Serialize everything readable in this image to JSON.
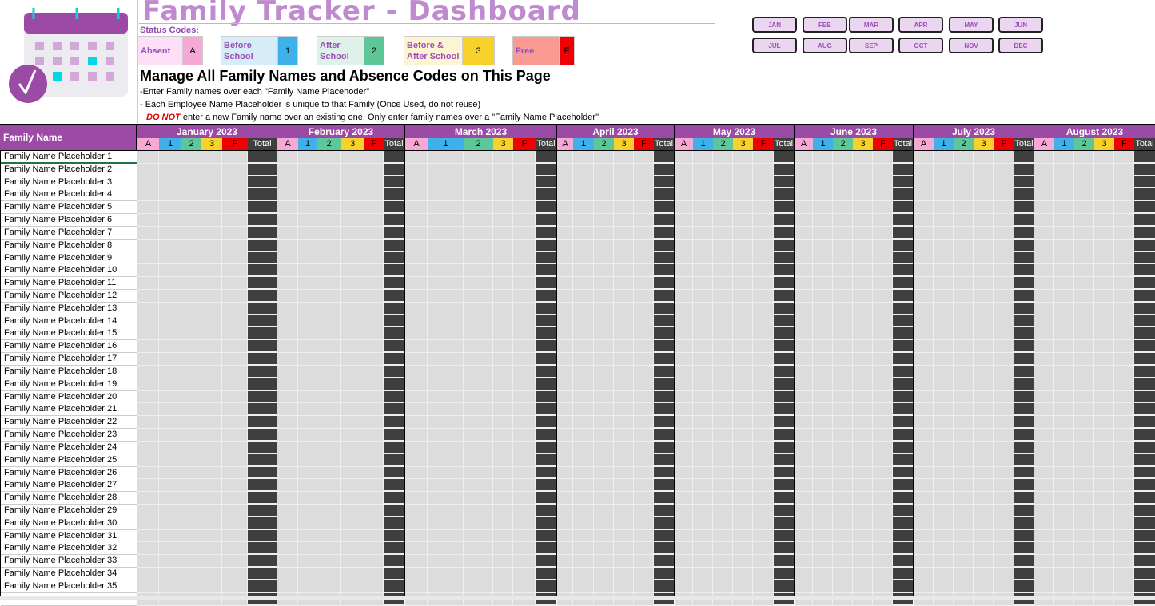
{
  "title": "Family Tracker - Dashboard",
  "status_label": "Status Codes:",
  "status_codes": [
    {
      "label": "Absent",
      "key": "A",
      "bg": "#fde0f8",
      "key_bg": "#f7a8d4"
    },
    {
      "label": "Before School",
      "key": "1",
      "bg": "#d6ecf7",
      "key_bg": "#3fb1ea"
    },
    {
      "label": "After School",
      "key": "2",
      "bg": "#dff2ea",
      "key_bg": "#5ec79a"
    },
    {
      "label": "Before & After School",
      "key": "3",
      "bg": "#fdf4d4",
      "key_bg": "#f8d12a"
    },
    {
      "label": "Free",
      "key": "F",
      "bg": "#fb9a93",
      "key_bg": "#f00000"
    }
  ],
  "heading": "Manage All Family Names and Absence Codes on This Page",
  "notes": {
    "line1": "-Enter Family names over each \"Family Name Placehoder\"",
    "line2": "-  Each Employee Name Placeholder is unique to that Family (Once Used, do not reuse)",
    "line3_warn": "DO NOT",
    "line3": " enter a new Family name over an existing one.  Only enter family names over a \"Family Name Placeholder\""
  },
  "month_buttons": [
    "JAN",
    "FEB",
    "MAR",
    "APR",
    "MAY",
    "JUN",
    "JUL",
    "AUG",
    "SEP",
    "OCT",
    "NOV",
    "DEC"
  ],
  "grid": {
    "name_header": "Family Name",
    "months": [
      "January 2023",
      "February 2023",
      "March 2023",
      "April 2023",
      "May 2023",
      "June 2023",
      "July 2023",
      "August 2023"
    ],
    "sub_headers": [
      "A",
      "1",
      "2",
      "3",
      "F",
      "Total"
    ],
    "sub_colors": [
      "#f7a8d4",
      "#3fb1ea",
      "#5ec79a",
      "#f8d12a",
      "#f00000",
      "#3f3f3f"
    ],
    "rows": [
      "Family Name Placeholder 1",
      "Family Name Placeholder 2",
      "Family Name Placeholder 3",
      "Family Name Placeholder 4",
      "Family Name Placeholder 5",
      "Family Name Placeholder 6",
      "Family Name Placeholder 7",
      "Family Name Placeholder 8",
      "Family Name Placeholder 9",
      "Family Name Placeholder 10",
      "Family Name Placeholder 11",
      "Family Name Placeholder 12",
      "Family Name Placeholder 13",
      "Family Name Placeholder 14",
      "Family Name Placeholder 15",
      "Family Name Placeholder 16",
      "Family Name Placeholder 17",
      "Family Name Placeholder 18",
      "Family Name Placeholder 19",
      "Family Name Placeholder 20",
      "Family Name Placeholder 21",
      "Family Name Placeholder 22",
      "Family Name Placeholder 23",
      "Family Name Placeholder 24",
      "Family Name Placeholder 25",
      "Family Name Placeholder 26",
      "Family Name Placeholder 27",
      "Family Name Placeholder 28",
      "Family Name Placeholder 29",
      "Family Name Placeholder 30",
      "Family Name Placeholder 31",
      "Family Name Placeholder 32",
      "Family Name Placeholder 33",
      "Family Name Placeholder 34",
      "Family Name Placeholder 35"
    ]
  }
}
